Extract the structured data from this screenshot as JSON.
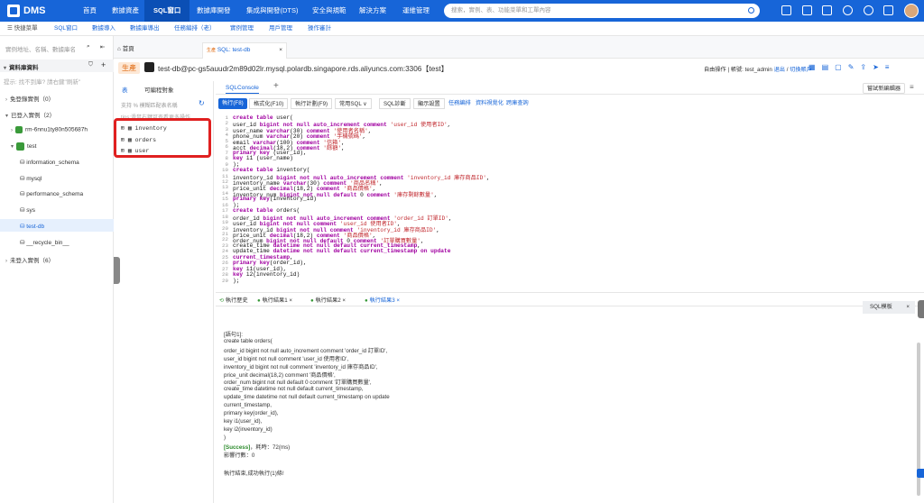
{
  "topbar": {
    "logo": "DMS",
    "nav": [
      "首頁",
      "數據資產",
      "SQL窗口",
      "數據庫開發",
      "集成與開發(DTS)",
      "安全與規範",
      "解決方案",
      "運維管理"
    ],
    "search_placeholder": "搜索，實例、表、功能菜單和工單內容"
  },
  "row2": {
    "quick_menu": "快捷菜單",
    "links": [
      "SQL窗口",
      "數據導入",
      "數據庫導出",
      "任務編排（老）",
      "實例管理",
      "用戶管理",
      "操作審計"
    ]
  },
  "sidebar": {
    "search_placeholder": "實例地址、名稱、數據庫名",
    "header": "資料庫資料",
    "hint": "提示: 找不到庫? 請右鍵\"刷新\"",
    "unlogged": "免登錄實例（0）",
    "logged": "已登入實例（2）",
    "instance": "rm-6nnu1ty80n505687h",
    "db_group": "test",
    "dbs": [
      "information_schema",
      "mysql",
      "performance_schema",
      "sys",
      "test-db",
      "__recycle_bin__"
    ],
    "unlogged2": "未登入實例（6）"
  },
  "tabs": {
    "home": "首頁",
    "active": "SQL: test-db",
    "active_badge": "生產"
  },
  "conn": {
    "env": "生產",
    "title": "test-db@pc-gs5auudr2m89d02lr.mysql.polardb.singapore.rds.aliyuncs.com:3306【test】",
    "right": "自由操作 | 帳號: test_admin",
    "links": [
      "退出",
      "切換賬戶"
    ]
  },
  "left_panel": {
    "tabs": [
      "表",
      "可編程對象"
    ],
    "search": "支持 % 模糊匹配表名稱",
    "tip": "tips:滑鼠右鍵可查看更多操作...",
    "tables": [
      "inventory",
      "orders",
      "user"
    ]
  },
  "editor": {
    "tab": "SQLConsole",
    "buttons": [
      "執行(F8)",
      "格式化(F10)",
      "執行計劃(F9)",
      "常用SQL ∨",
      "SQL診斷",
      "顯示設置"
    ],
    "links": [
      "任務編排",
      "資料視覺化",
      "跨庫查詢"
    ],
    "try_btn": "嘗試新編輯器"
  },
  "code_lines": [
    {
      "n": "1",
      "t": "create table user("
    },
    {
      "n": "2",
      "t": "user_id bigint not null auto_increment comment 'user_id 使用者ID',"
    },
    {
      "n": "3",
      "t": "user_name varchar(30) comment '使用者名稱',"
    },
    {
      "n": "4",
      "t": "phone_num varchar(20) comment '手機號碼',"
    },
    {
      "n": "5",
      "t": "email varchar(100) comment '信箱',"
    },
    {
      "n": "6",
      "t": "acct decimal(18,2) comment '餘額',"
    },
    {
      "n": "7",
      "t": "primary key (user_id),"
    },
    {
      "n": "8",
      "t": "key i1 (user_name)"
    },
    {
      "n": "9",
      "t": ");"
    },
    {
      "n": "10",
      "t": "create table inventory("
    },
    {
      "n": "11",
      "t": "inventory_id bigint not null auto_increment comment 'inventory_id 庫存商品ID',"
    },
    {
      "n": "12",
      "t": "inventory_name varchar(30) comment '商品名稱',"
    },
    {
      "n": "13",
      "t": "price_unit decimal(18,2) comment '商品價格',"
    },
    {
      "n": "14",
      "t": "inventory_num bigint not null default 0 comment '庫存剩餘數量',"
    },
    {
      "n": "15",
      "t": "primary key(inventory_id)"
    },
    {
      "n": "16",
      "t": ");"
    },
    {
      "n": "17",
      "t": "create table orders("
    },
    {
      "n": "18",
      "t": "order_id bigint not null auto_increment comment 'order_id 訂單ID',"
    },
    {
      "n": "19",
      "t": "user_id bigint not null comment 'user_id 使用者ID',"
    },
    {
      "n": "20",
      "t": "inventory_id bigint not null comment 'inventory_id 庫存商品ID',"
    },
    {
      "n": "21",
      "t": "price_unit decimal(18,2) comment '商品價格',"
    },
    {
      "n": "22",
      "t": "order_num bigint not null default 0 comment '訂單購買數量',"
    },
    {
      "n": "23",
      "t": "create_time datetime not null default current_timestamp,"
    },
    {
      "n": "24",
      "t": "update_time datetime not null default current_timestamp on update"
    },
    {
      "n": "25",
      "t": "current_timestamp,"
    },
    {
      "n": "26",
      "t": "primary key(order_id),"
    },
    {
      "n": "27",
      "t": "key i1(user_id),"
    },
    {
      "n": "28",
      "t": "key i2(inventory_id)"
    },
    {
      "n": "29",
      "t": ");"
    }
  ],
  "results": {
    "tabs": [
      "執行歷史",
      "執行結果1",
      "執行結果2",
      "執行結果3"
    ],
    "sql_template": "SQL模板",
    "lines": [
      "[語句1]:",
      "create table orders(",
      "order_id bigint not null auto_increment comment 'order_id 訂單ID',",
      "user_id bigint not null comment 'user_id 使用者ID',",
      "inventory_id bigint not null comment 'inventory_id 庫存商品ID',",
      "price_unit decimal(18,2) comment '商品價格',",
      "order_num bigint not null default 0 comment '訂單購買數量',",
      "create_time datetime not null default current_timestamp,",
      "update_time datetime not null default current_timestamp on update",
      "current_timestamp,",
      "primary key(order_id),",
      "key i1(user_id),",
      "key i2(inventory_id)",
      ")"
    ],
    "success": "[Success]",
    "elapsed": "，耗時：72(ms)",
    "affected": "影響行數：0",
    "done": "執行結束,成功執行(1)條!"
  }
}
